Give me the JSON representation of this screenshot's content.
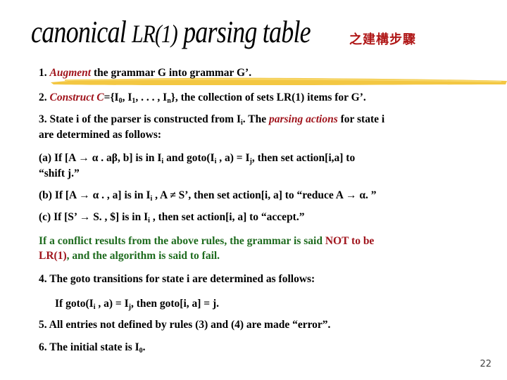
{
  "title": {
    "main_part1": "canonical ",
    "main_part2": "LR(1)",
    "main_part3": " parsing table",
    "chinese": "之建構步驟"
  },
  "colors": {
    "accent_red": "#a0141c",
    "accent_green": "#1e6b1e",
    "highlight_yellow": "#f2c12e"
  },
  "steps": {
    "s1": {
      "num": "1. ",
      "keyword": "Augment",
      "text": " the grammar G into grammar G’."
    },
    "s2": {
      "num": "2. ",
      "keyword": "Construct C",
      "pre": "={I",
      "i0": "0",
      "c1": ", I",
      "i1": "1",
      "c2": ", . . . , I",
      "in": "n",
      "post": "}, the collection of sets LR(1) items for G’."
    },
    "s3": {
      "pre": "3. State  i  of  the  parser is constructed from I",
      "sub": "i",
      "mid": ". The ",
      "keyword": "parsing  actions",
      "post": " for state  i",
      "line2": "are  determined  as   follows:"
    },
    "a": {
      "pre": "(a)  If  [A → α . aβ,  b]  is   in  I",
      "sub1": "i",
      "mid1": "  and   goto(I",
      "sub2": "i",
      "mid2": " , a) = I",
      "sub3": "j",
      "post": ",   then  set  action[i,a]  to",
      "line2": "“shift  j.”"
    },
    "b": {
      "pre": "(b)  If [A → α . ,  a]  is   in  I",
      "sub1": "i",
      "post": " ,  A ≠ S’, then set  action[i, a]  to  “reduce  A → α. ”"
    },
    "c": {
      "pre": "(c)  If [S’ → S. , $]  is   in I",
      "sub1": "i",
      "post": " ,   then set  action[i, a]  to  “accept.”"
    },
    "conflict": {
      "green1": "If a conflict results   from the  above  rules,  the grammar  is  said  ",
      "red1": "NOT to be",
      "red2": "LR(1)",
      "green2": ", and  the  algorithm  is  said  to  fail."
    },
    "s4": {
      "text": "4.  The  goto  transitions  for  state  i  are  determined  as  follows:",
      "pre": "If goto(I",
      "sub1": "i",
      "mid": " , a) = I",
      "sub2": "j",
      "post": ", then  goto[i, a] = j."
    },
    "s5": {
      "text": "5.  All  entries  not  defined  by rules (3) and (4)  are  made  “error”."
    },
    "s6": {
      "pre": "6.  The initial state  is  I",
      "sub": "0",
      "post": "."
    }
  },
  "page_number": "22"
}
